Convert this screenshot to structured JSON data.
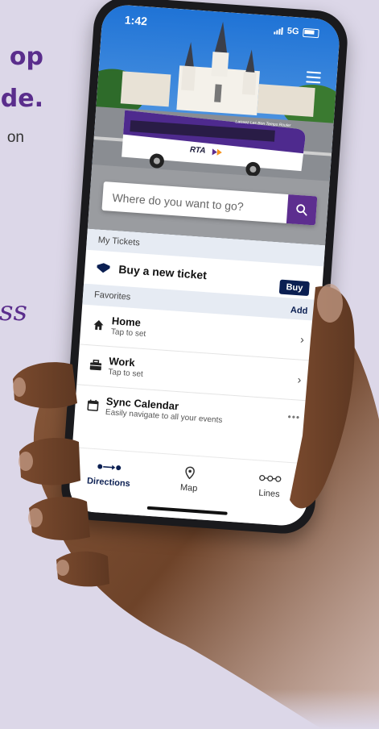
{
  "background": {
    "headline_line1": "op",
    "headline_line2": "de.",
    "subtext": "on",
    "script_text": "ss"
  },
  "status_bar": {
    "time": "1:42",
    "network": "5G"
  },
  "hero": {
    "bus_brand": "RTA",
    "bus_slogan": "Laissez Les Bon Temps Rouler"
  },
  "search": {
    "placeholder": "Where do you want to go?"
  },
  "tickets": {
    "section_label": "My Tickets",
    "buy_new_label": "Buy a new ticket",
    "buy_button": "Buy"
  },
  "favorites": {
    "section_label": "Favorites",
    "add_label": "Add",
    "items": [
      {
        "title": "Home",
        "subtitle": "Tap to set",
        "icon": "house-icon"
      },
      {
        "title": "Work",
        "subtitle": "Tap to set",
        "icon": "briefcase-icon"
      },
      {
        "title": "Sync Calendar",
        "subtitle": "Easily navigate to all your events",
        "icon": "calendar-icon"
      }
    ]
  },
  "bottom_nav": {
    "items": [
      {
        "label": "Directions",
        "icon": "directions-icon",
        "active": true
      },
      {
        "label": "Map",
        "icon": "map-pin-icon",
        "active": false
      },
      {
        "label": "Lines",
        "icon": "lines-icon",
        "active": false
      }
    ]
  },
  "colors": {
    "brand_purple": "#5d2e8f",
    "navy": "#0b1f52",
    "page_background": "#dcd7e8",
    "section_header": "#e6ebf3"
  }
}
